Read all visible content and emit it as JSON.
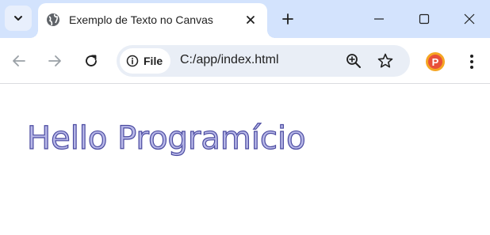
{
  "tabstrip": {
    "search_tabs_icon": "chevron-down-icon",
    "tab": {
      "title": "Exemplo de Texto no Canvas",
      "favicon": "globe-icon",
      "close_icon": "close-icon"
    },
    "new_tab_icon": "plus-icon",
    "window_controls": [
      "minimize-icon",
      "maximize-icon",
      "close-icon"
    ]
  },
  "toolbar": {
    "back_icon": "arrow-left-icon",
    "forward_icon": "arrow-right-icon",
    "reload_icon": "reload-icon",
    "site_info_label": "File",
    "site_info_icon": "info-icon",
    "url": "C:/app/index.html",
    "zoom_icon": "zoom-in-icon",
    "bookmark_icon": "star-icon",
    "profile_letter": "P",
    "menu_icon": "more-vert-icon"
  },
  "page": {
    "canvas_text": "Hello Programício",
    "text_fill_color": "#b8b8e8",
    "text_stroke_color": "#4a4aa0"
  },
  "colors": {
    "tabstrip_bg": "#d3e3fd",
    "omnibox_bg": "#e9eef6",
    "profile_orange": "#f5a623"
  }
}
